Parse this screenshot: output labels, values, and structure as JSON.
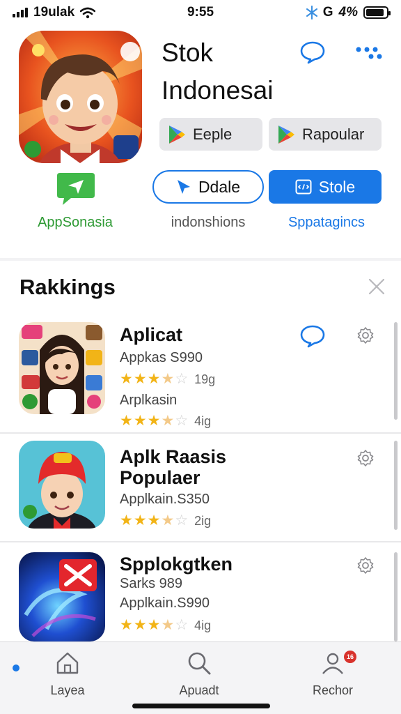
{
  "status_bar": {
    "carrier": "19ulak",
    "time": "9:55",
    "network": "G",
    "battery_text": "4%",
    "battery_level": 0.9,
    "icons": [
      "signal-icon",
      "wifi-icon",
      "bluetooth-icon",
      "battery-icon"
    ]
  },
  "header": {
    "title_line1": "Stok",
    "title_line2": "Indonesai",
    "store_buttons": [
      "Eeple",
      "Rapoular"
    ],
    "outline_button": "Ddale",
    "solid_button": "Stole",
    "messages_label": "AppSonasia",
    "sub_label_middle": "indonshions",
    "sub_label_right": "Sppatagincs",
    "colors": {
      "accent": "#1a78e6",
      "green": "#2e9a34"
    }
  },
  "rankings": {
    "title": "Rakkings",
    "items": [
      {
        "name": "Aplicat",
        "meta1": "Appkas S990",
        "rating": 3.5,
        "count1": "19g",
        "meta2": "Arplkasin",
        "rating2": 3.5,
        "count2": "4ig"
      },
      {
        "name_line1": "Aplk Raasis",
        "name_line2": "Populaer",
        "meta1": "Applkain.S350",
        "rating": 3.5,
        "count1": "2ig"
      },
      {
        "name": "Spplokgtken",
        "meta1": "Sarks 989",
        "meta2": "Applkain.S990",
        "rating": 3.5,
        "count1": "4ig"
      }
    ]
  },
  "tabbar": {
    "tabs": [
      "Layea",
      "Apuadt",
      "Rechor"
    ],
    "badge": "16"
  }
}
